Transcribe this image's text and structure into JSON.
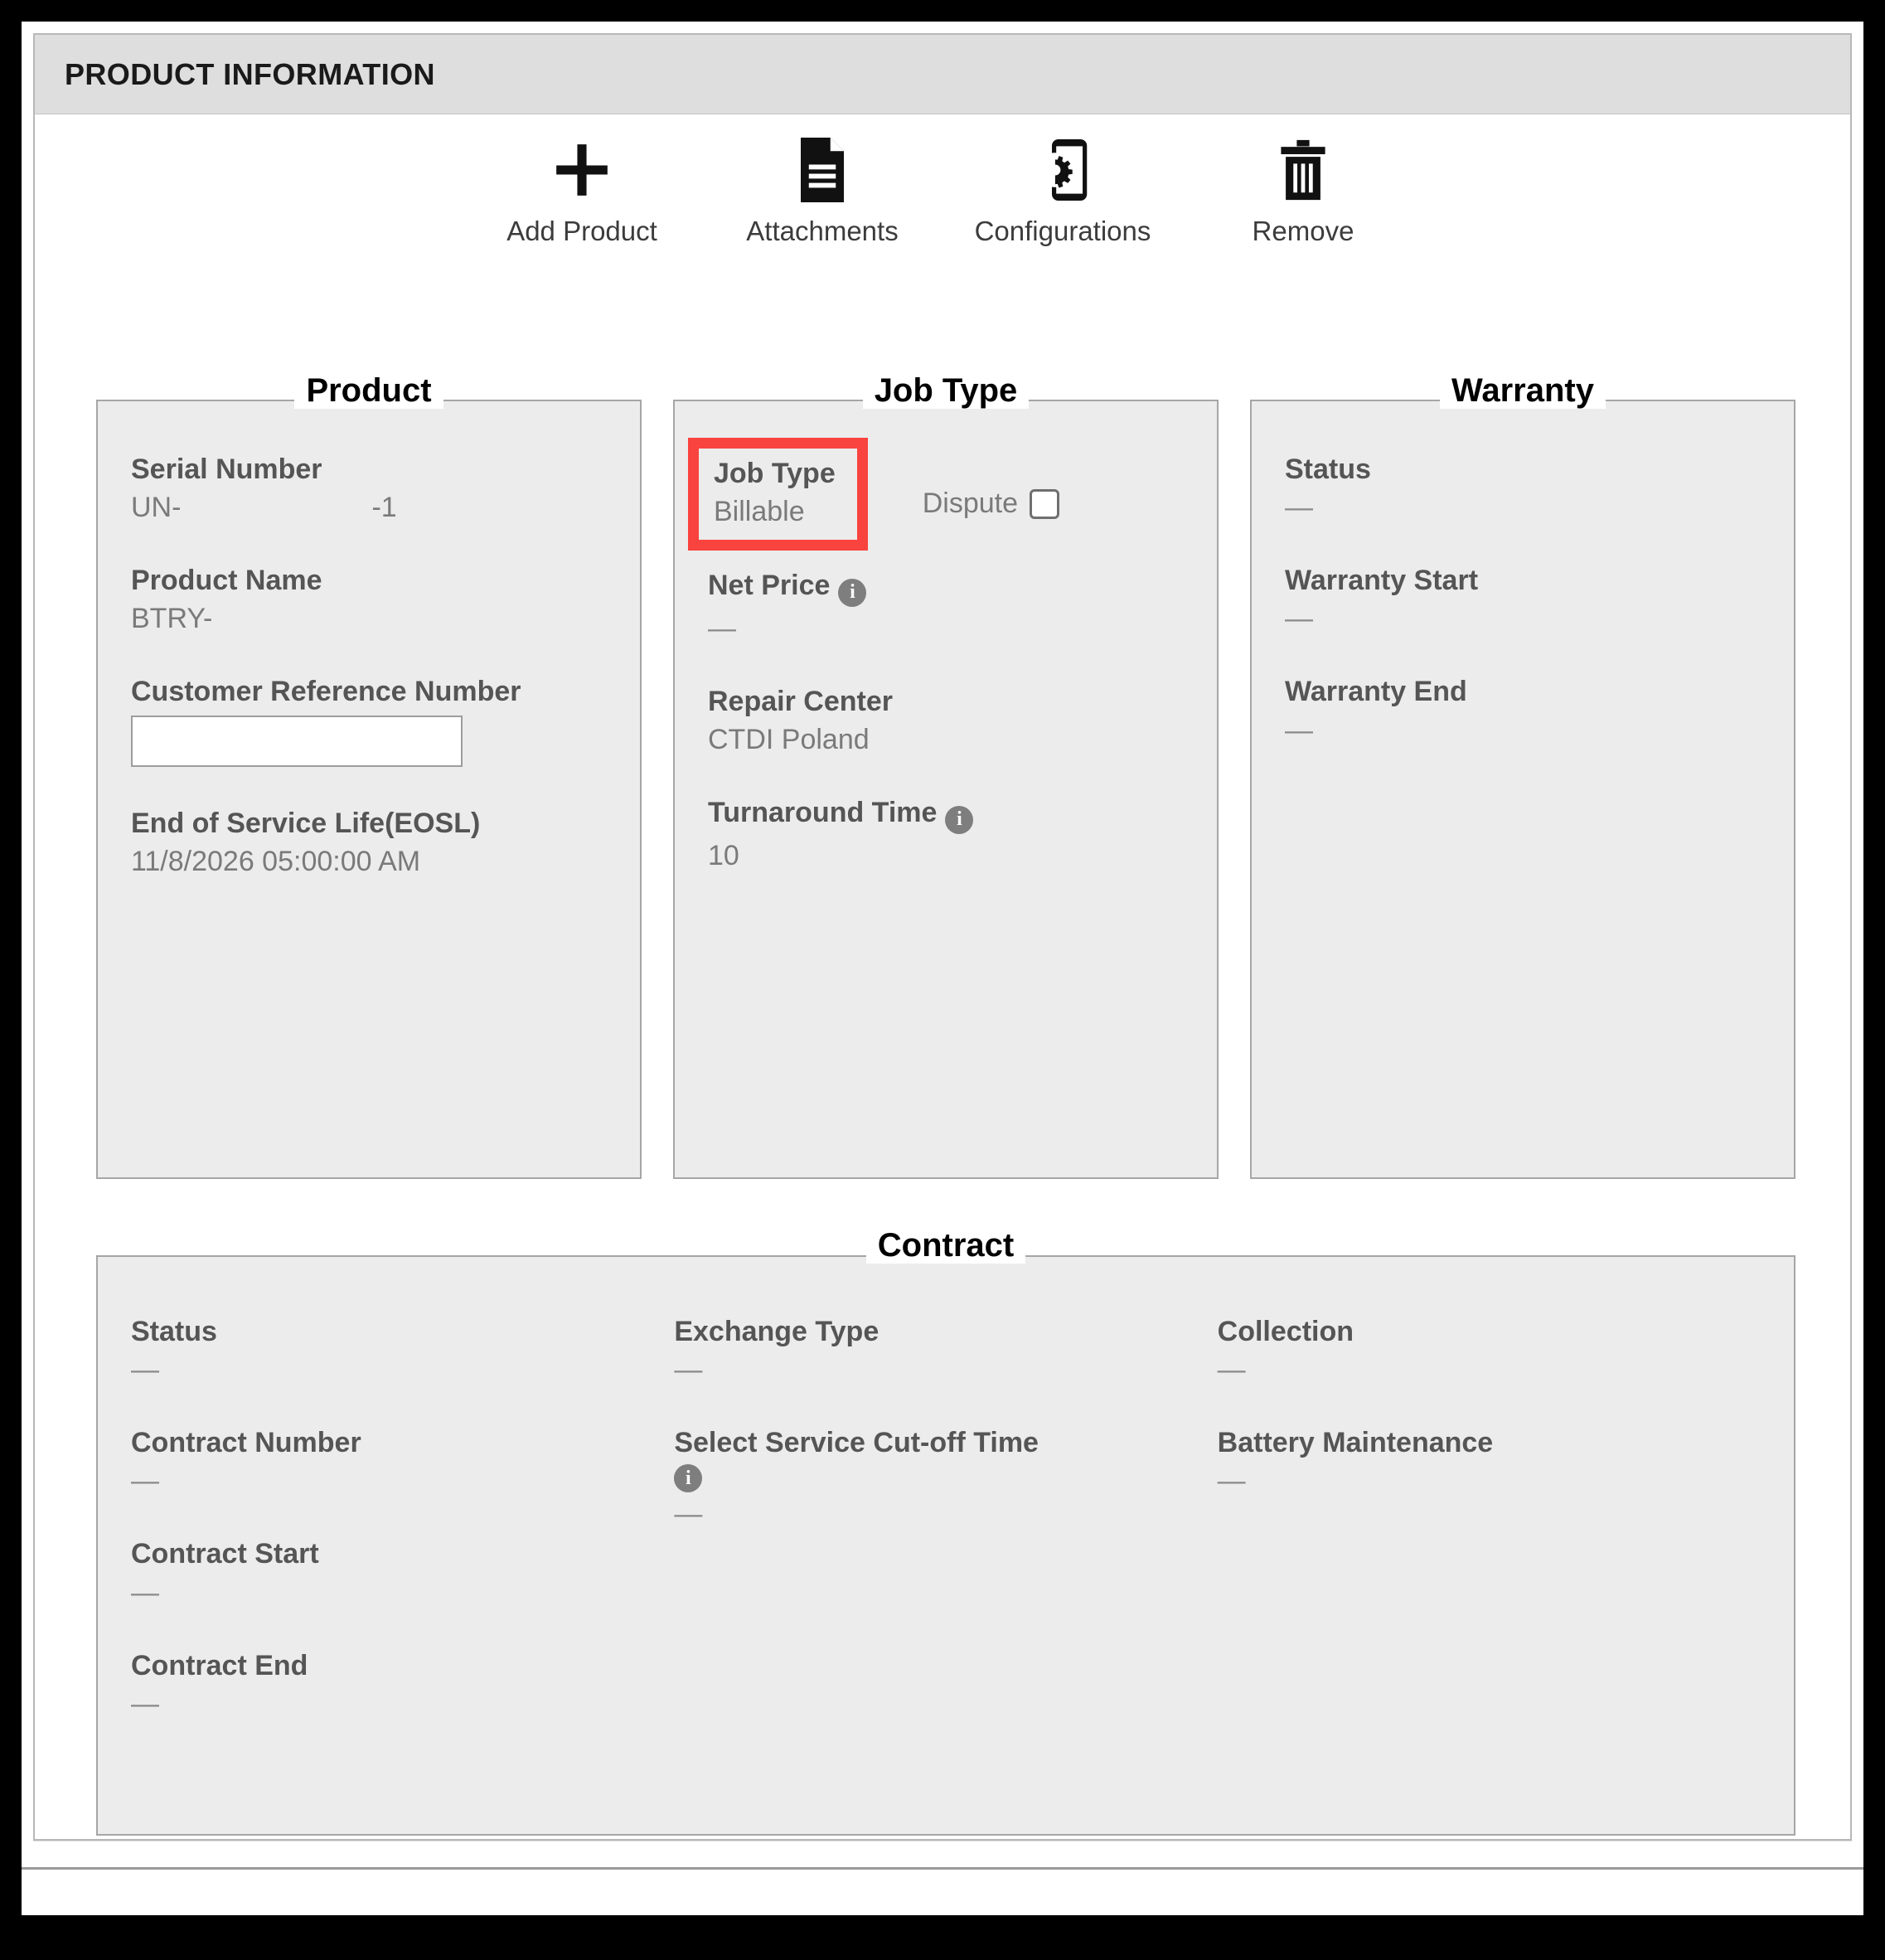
{
  "header": {
    "title": "PRODUCT INFORMATION"
  },
  "toolbar": {
    "items": [
      {
        "label": "Add Product",
        "icon": "plus-icon"
      },
      {
        "label": "Attachments",
        "icon": "document-icon"
      },
      {
        "label": "Configurations",
        "icon": "device-gear-icon"
      },
      {
        "label": "Remove",
        "icon": "trash-icon"
      }
    ]
  },
  "product": {
    "legend": "Product",
    "serial_number_label": "Serial Number",
    "serial_number_prefix": "UN-",
    "serial_number_suffix": "-1",
    "product_name_label": "Product Name",
    "product_name_value": "BTRY-",
    "customer_reference_label": "Customer Reference Number",
    "customer_reference_value": "",
    "customer_reference_placeholder": "",
    "eosl_label": "End of Service Life(EOSL)",
    "eosl_value": "11/8/2026 05:00:00 AM"
  },
  "job_type": {
    "legend": "Job Type",
    "job_type_label": "Job Type",
    "job_type_value": "Billable",
    "dispute_label": "Dispute",
    "dispute_checked": false,
    "net_price_label": "Net Price",
    "net_price_value": "—",
    "repair_center_label": "Repair Center",
    "repair_center_value": "CTDI Poland",
    "turnaround_time_label": "Turnaround Time",
    "turnaround_time_value": "10",
    "highlight_color": "#f9433e"
  },
  "warranty": {
    "legend": "Warranty",
    "status_label": "Status",
    "status_value": "—",
    "start_label": "Warranty Start",
    "start_value": "—",
    "end_label": "Warranty End",
    "end_value": "—"
  },
  "contract": {
    "legend": "Contract",
    "status_label": "Status",
    "status_value": "—",
    "number_label": "Contract Number",
    "number_value": "—",
    "start_label": "Contract Start",
    "start_value": "—",
    "end_label": "Contract End",
    "end_value": "—",
    "exchange_type_label": "Exchange Type",
    "exchange_type_value": "—",
    "cutoff_label": "Select Service Cut-off Time",
    "cutoff_value": "—",
    "collection_label": "Collection",
    "collection_value": "—",
    "battery_label": "Battery Maintenance",
    "battery_value": "—"
  }
}
